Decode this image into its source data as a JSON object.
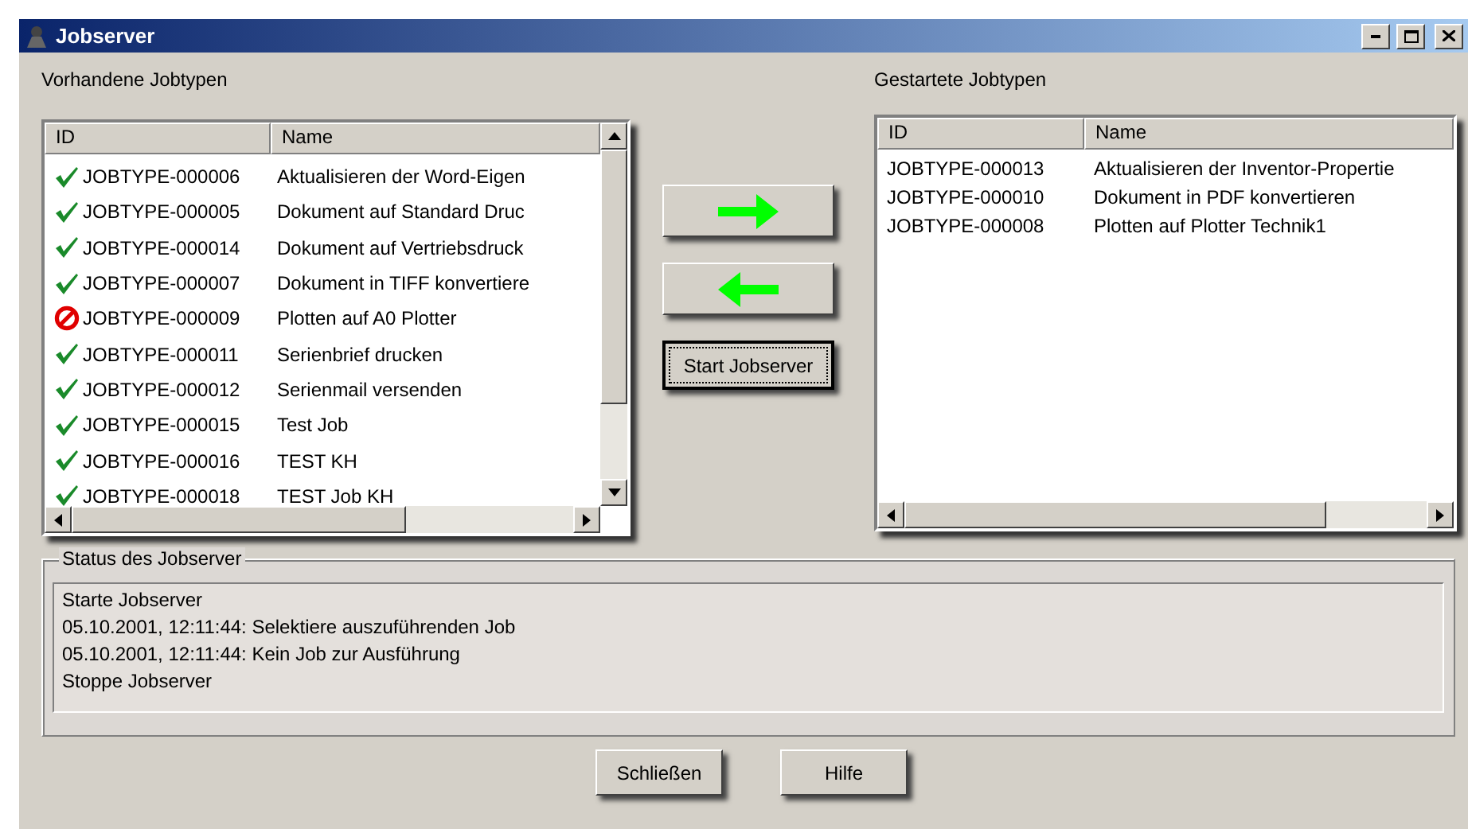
{
  "window": {
    "title": "Jobserver"
  },
  "available": {
    "label": "Vorhandene Jobtypen",
    "columns": [
      "ID",
      "Name"
    ],
    "rows": [
      {
        "enabled": true,
        "id": "JOBTYPE-000006",
        "name": "Aktualisieren der Word-Eigen"
      },
      {
        "enabled": true,
        "id": "JOBTYPE-000005",
        "name": "Dokument auf Standard Druc"
      },
      {
        "enabled": true,
        "id": "JOBTYPE-000014",
        "name": "Dokument auf Vertriebsdruck"
      },
      {
        "enabled": true,
        "id": "JOBTYPE-000007",
        "name": "Dokument in TIFF konvertiere"
      },
      {
        "enabled": false,
        "id": "JOBTYPE-000009",
        "name": "Plotten auf A0 Plotter"
      },
      {
        "enabled": true,
        "id": "JOBTYPE-000011",
        "name": "Serienbrief drucken"
      },
      {
        "enabled": true,
        "id": "JOBTYPE-000012",
        "name": "Serienmail versenden"
      },
      {
        "enabled": true,
        "id": "JOBTYPE-000015",
        "name": "Test Job"
      },
      {
        "enabled": true,
        "id": "JOBTYPE-000016",
        "name": "TEST KH"
      },
      {
        "enabled": true,
        "id": "JOBTYPE-000018",
        "name": "TEST Job KH"
      }
    ]
  },
  "transfer_buttons": [
    {
      "kind": "add"
    },
    {
      "kind": "remove"
    }
  ],
  "start_button": "Start Jobserver",
  "started": {
    "label": "Gestartete Jobtypen",
    "columns": [
      "ID",
      "Name"
    ],
    "rows": [
      {
        "id": "JOBTYPE-000013",
        "name": "Aktualisieren der Inventor-Propertie"
      },
      {
        "id": "JOBTYPE-000010",
        "name": "Dokument in PDF konvertieren"
      },
      {
        "id": "JOBTYPE-000008",
        "name": "Plotten auf Plotter Technik1"
      }
    ]
  },
  "status": {
    "title": "Status des Jobserver",
    "lines": [
      "Starte Jobserver",
      "05.10.2001, 12:11:44: Selektiere auszuführenden Job",
      "05.10.2001, 12:11:44: Kein Job zur Ausführung",
      "Stoppe Jobserver"
    ]
  },
  "buttons": [
    "Schließen",
    "Hilfe"
  ]
}
